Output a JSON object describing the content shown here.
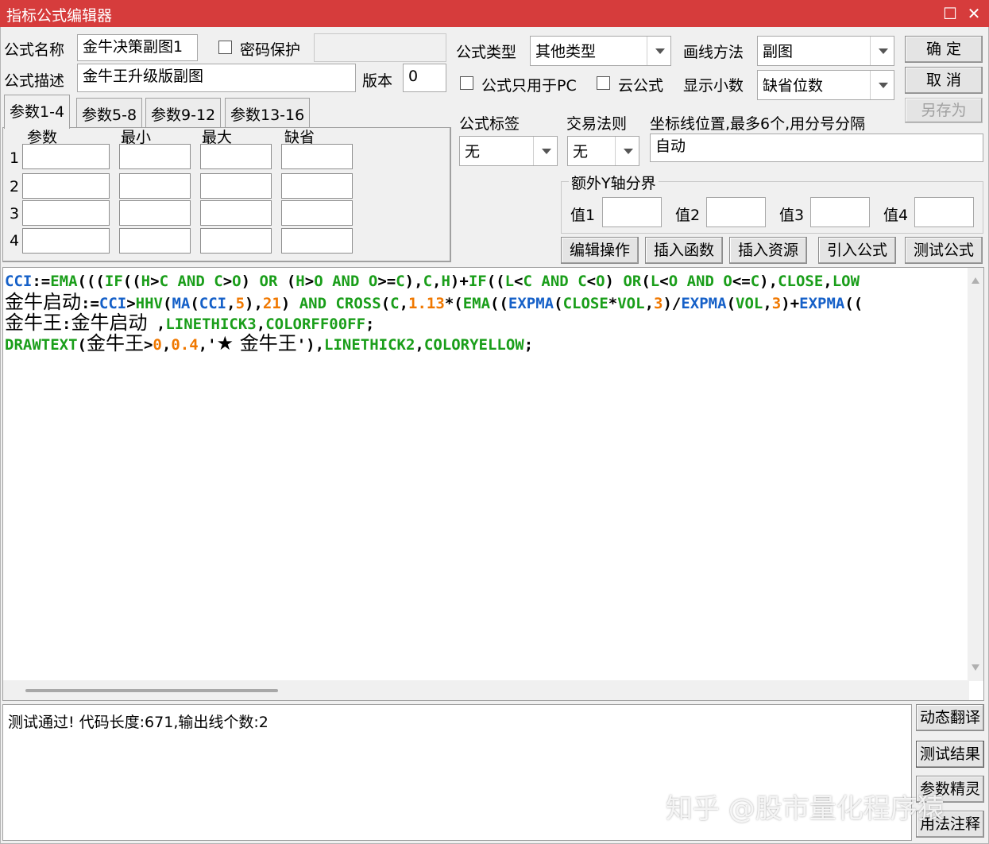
{
  "window": {
    "title": "指标公式编辑器",
    "maximize_icon": "☐",
    "close_icon": "✕"
  },
  "form": {
    "name_label": "公式名称",
    "name_value": "金牛决策副图1",
    "password_label": "密码保护",
    "password_value": "",
    "desc_label": "公式描述",
    "desc_value": "金牛王升级版副图",
    "version_label": "版本",
    "version_value": "0",
    "type_label": "公式类型",
    "type_value": "其他类型",
    "draw_label": "画线方法",
    "draw_value": "副图",
    "pc_only_label": "公式只用于PC",
    "cloud_label": "云公式",
    "decimal_label": "显示小数",
    "decimal_value": "缺省位数",
    "tag_label": "公式标签",
    "tag_value": "无",
    "rule_label": "交易法则",
    "rule_value": "无",
    "coord_label": "坐标线位置,最多6个,用分号分隔",
    "coord_value": "自动",
    "yaxis_group_label": "额外Y轴分界",
    "y_labels": [
      "值1",
      "值2",
      "值3",
      "值4"
    ]
  },
  "buttons": {
    "ok": "确  定",
    "cancel": "取  消",
    "save_as": "另存为",
    "edit_ops": "编辑操作",
    "insert_func": "插入函数",
    "insert_res": "插入资源",
    "import_formula": "引入公式",
    "test_formula": "测试公式",
    "dynamic_translate": "动态翻译",
    "test_result": "测试结果",
    "param_wizard": "参数精灵",
    "usage_notes": "用法注释"
  },
  "params": {
    "tabs": [
      "参数1-4",
      "参数5-8",
      "参数9-12",
      "参数13-16"
    ],
    "headers": [
      "参数",
      "最小",
      "最大",
      "缺省"
    ],
    "rows": [
      "1",
      "2",
      "3",
      "4"
    ]
  },
  "code_colors": {
    "keyword": "#1a9e1a",
    "function": "#1560c8",
    "number": "#f07800",
    "text": "#000000"
  },
  "code": {
    "lines": [
      [
        {
          "t": "CCI",
          "k": "function"
        },
        {
          "t": ":=",
          "k": "text"
        },
        {
          "t": "EMA",
          "k": "keyword"
        },
        {
          "t": "(((",
          "k": "text"
        },
        {
          "t": "IF",
          "k": "keyword"
        },
        {
          "t": "((",
          "k": "text"
        },
        {
          "t": "H",
          "k": "keyword"
        },
        {
          "t": ">",
          "k": "text"
        },
        {
          "t": "C",
          "k": "keyword"
        },
        {
          "t": " ",
          "k": "text"
        },
        {
          "t": "AND",
          "k": "keyword"
        },
        {
          "t": " ",
          "k": "text"
        },
        {
          "t": "C",
          "k": "keyword"
        },
        {
          "t": ">",
          "k": "text"
        },
        {
          "t": "O",
          "k": "keyword"
        },
        {
          "t": ") ",
          "k": "text"
        },
        {
          "t": "OR",
          "k": "keyword"
        },
        {
          "t": " (",
          "k": "text"
        },
        {
          "t": "H",
          "k": "keyword"
        },
        {
          "t": ">",
          "k": "text"
        },
        {
          "t": "O",
          "k": "keyword"
        },
        {
          "t": " ",
          "k": "text"
        },
        {
          "t": "AND",
          "k": "keyword"
        },
        {
          "t": " ",
          "k": "text"
        },
        {
          "t": "O",
          "k": "keyword"
        },
        {
          "t": ">=",
          "k": "text"
        },
        {
          "t": "C",
          "k": "keyword"
        },
        {
          "t": "),",
          "k": "text"
        },
        {
          "t": "C",
          "k": "keyword"
        },
        {
          "t": ",",
          "k": "text"
        },
        {
          "t": "H",
          "k": "keyword"
        },
        {
          "t": ")+",
          "k": "text"
        },
        {
          "t": "IF",
          "k": "keyword"
        },
        {
          "t": "((",
          "k": "text"
        },
        {
          "t": "L",
          "k": "keyword"
        },
        {
          "t": "<",
          "k": "text"
        },
        {
          "t": "C",
          "k": "keyword"
        },
        {
          "t": " ",
          "k": "text"
        },
        {
          "t": "AND",
          "k": "keyword"
        },
        {
          "t": " ",
          "k": "text"
        },
        {
          "t": "C",
          "k": "keyword"
        },
        {
          "t": "<",
          "k": "text"
        },
        {
          "t": "O",
          "k": "keyword"
        },
        {
          "t": ") ",
          "k": "text"
        },
        {
          "t": "OR",
          "k": "keyword"
        },
        {
          "t": "(",
          "k": "text"
        },
        {
          "t": "L",
          "k": "keyword"
        },
        {
          "t": "<",
          "k": "text"
        },
        {
          "t": "O",
          "k": "keyword"
        },
        {
          "t": " ",
          "k": "text"
        },
        {
          "t": "AND",
          "k": "keyword"
        },
        {
          "t": " ",
          "k": "text"
        },
        {
          "t": "O",
          "k": "keyword"
        },
        {
          "t": "<=",
          "k": "text"
        },
        {
          "t": "C",
          "k": "keyword"
        },
        {
          "t": "),",
          "k": "text"
        },
        {
          "t": "CLOSE",
          "k": "keyword"
        },
        {
          "t": ",",
          "k": "text"
        },
        {
          "t": "LOW",
          "k": "keyword"
        }
      ],
      [
        {
          "t": "金牛启动",
          "k": "cn"
        },
        {
          "t": ":=",
          "k": "text"
        },
        {
          "t": "CCI",
          "k": "function"
        },
        {
          "t": ">",
          "k": "text"
        },
        {
          "t": "HHV",
          "k": "keyword"
        },
        {
          "t": "(",
          "k": "text"
        },
        {
          "t": "MA",
          "k": "function"
        },
        {
          "t": "(",
          "k": "text"
        },
        {
          "t": "CCI",
          "k": "function"
        },
        {
          "t": ",",
          "k": "text"
        },
        {
          "t": "5",
          "k": "number"
        },
        {
          "t": "),",
          "k": "text"
        },
        {
          "t": "21",
          "k": "number"
        },
        {
          "t": ") ",
          "k": "text"
        },
        {
          "t": "AND",
          "k": "keyword"
        },
        {
          "t": " ",
          "k": "text"
        },
        {
          "t": "CROSS",
          "k": "keyword"
        },
        {
          "t": "(",
          "k": "text"
        },
        {
          "t": "C",
          "k": "keyword"
        },
        {
          "t": ",",
          "k": "text"
        },
        {
          "t": "1.13",
          "k": "number"
        },
        {
          "t": "*(",
          "k": "text"
        },
        {
          "t": "EMA",
          "k": "keyword"
        },
        {
          "t": "((",
          "k": "text"
        },
        {
          "t": "EXPMA",
          "k": "function"
        },
        {
          "t": "(",
          "k": "text"
        },
        {
          "t": "CLOSE",
          "k": "keyword"
        },
        {
          "t": "*",
          "k": "text"
        },
        {
          "t": "VOL",
          "k": "keyword"
        },
        {
          "t": ",",
          "k": "text"
        },
        {
          "t": "3",
          "k": "number"
        },
        {
          "t": ")/",
          "k": "text"
        },
        {
          "t": "EXPMA",
          "k": "function"
        },
        {
          "t": "(",
          "k": "text"
        },
        {
          "t": "VOL",
          "k": "keyword"
        },
        {
          "t": ",",
          "k": "text"
        },
        {
          "t": "3",
          "k": "number"
        },
        {
          "t": ")+",
          "k": "text"
        },
        {
          "t": "EXPMA",
          "k": "function"
        },
        {
          "t": "((",
          "k": "text"
        }
      ],
      [
        {
          "t": "金牛王",
          "k": "cn"
        },
        {
          "t": ":",
          "k": "text"
        },
        {
          "t": "金牛启动",
          "k": "cn"
        },
        {
          "t": " ,",
          "k": "text"
        },
        {
          "t": "LINETHICK3",
          "k": "keyword"
        },
        {
          "t": ",",
          "k": "text"
        },
        {
          "t": "COLORFF00FF",
          "k": "keyword"
        },
        {
          "t": ";",
          "k": "text"
        }
      ],
      [
        {
          "t": "DRAWTEXT",
          "k": "keyword"
        },
        {
          "t": "(",
          "k": "text"
        },
        {
          "t": "金牛王",
          "k": "cn"
        },
        {
          "t": ">",
          "k": "text"
        },
        {
          "t": "0",
          "k": "number"
        },
        {
          "t": ",",
          "k": "text"
        },
        {
          "t": "0.4",
          "k": "number"
        },
        {
          "t": ",'",
          "k": "text"
        },
        {
          "t": "★ 金牛王",
          "k": "cn"
        },
        {
          "t": "'),",
          "k": "text"
        },
        {
          "t": "LINETHICK2",
          "k": "keyword"
        },
        {
          "t": ",",
          "k": "text"
        },
        {
          "t": "COLORYELLOW",
          "k": "keyword"
        },
        {
          "t": ";",
          "k": "text"
        }
      ]
    ]
  },
  "output": {
    "message": "测试通过! 代码长度:671,输出线个数:2"
  },
  "watermark": "知乎 @股市量化程序猿"
}
